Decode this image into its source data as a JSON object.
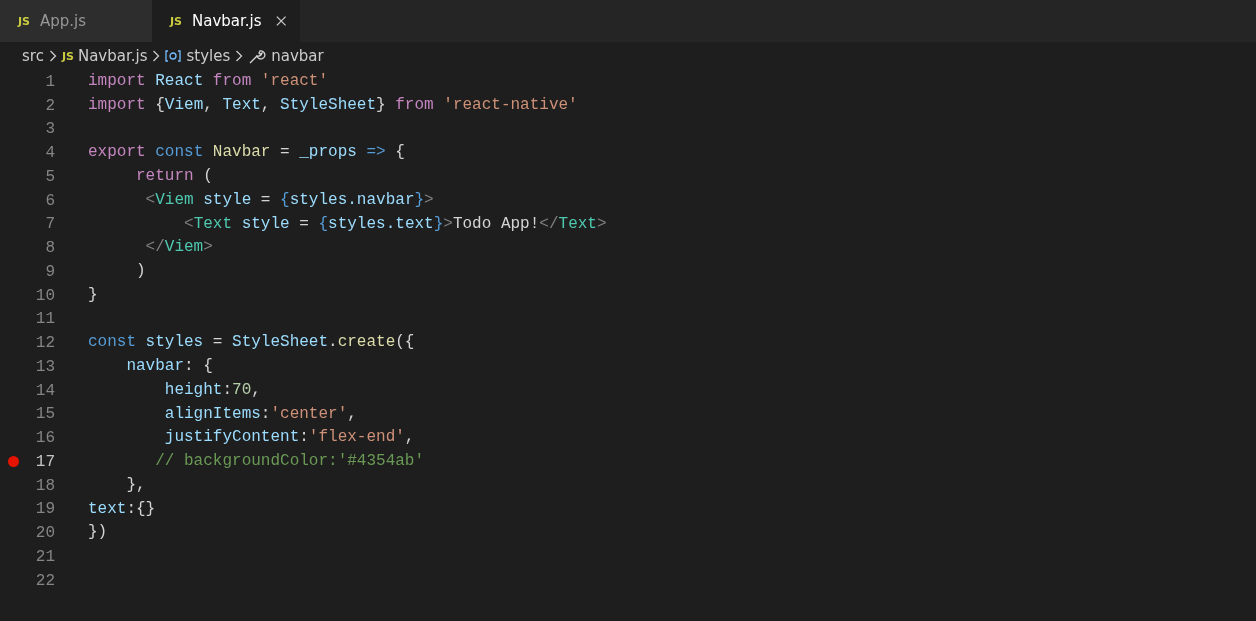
{
  "tabs": [
    {
      "icon_text": "JS",
      "label": "App.js",
      "selected": false
    },
    {
      "icon_text": "JS",
      "label": "Navbar.js",
      "selected": true
    }
  ],
  "breadcrumb": [
    {
      "kind": "folder",
      "label": "src"
    },
    {
      "kind": "file",
      "icon_text": "JS",
      "label": "Navbar.js"
    },
    {
      "kind": "variable",
      "label": "styles"
    },
    {
      "kind": "property",
      "label": "navbar"
    }
  ],
  "lines": [
    {
      "number": "1",
      "breakpoint": false,
      "tokens": [
        {
          "kind": "keyword",
          "text": "import "
        },
        {
          "kind": "variable",
          "text": "React "
        },
        {
          "kind": "keyword",
          "text": "from "
        },
        {
          "kind": "string",
          "text": "'react'"
        }
      ]
    },
    {
      "number": "2",
      "breakpoint": false,
      "tokens": [
        {
          "kind": "keyword",
          "text": "import "
        },
        {
          "kind": "plain",
          "text": "{"
        },
        {
          "kind": "variable",
          "text": "Viem"
        },
        {
          "kind": "plain",
          "text": ", "
        },
        {
          "kind": "variable",
          "text": "Text"
        },
        {
          "kind": "plain",
          "text": ", "
        },
        {
          "kind": "variable",
          "text": "StyleSheet"
        },
        {
          "kind": "plain",
          "text": "} "
        },
        {
          "kind": "keyword",
          "text": "from "
        },
        {
          "kind": "string",
          "text": "'react-native'"
        }
      ]
    },
    {
      "number": "3",
      "breakpoint": false
    },
    {
      "number": "4",
      "breakpoint": false,
      "tokens": [
        {
          "kind": "keyword",
          "text": "export "
        },
        {
          "kind": "storage",
          "text": "const "
        },
        {
          "kind": "function",
          "text": "Navbar "
        },
        {
          "kind": "plain",
          "text": "= "
        },
        {
          "kind": "variable",
          "text": "_props "
        },
        {
          "kind": "storage",
          "text": "=> "
        },
        {
          "kind": "plain",
          "text": "{"
        }
      ]
    },
    {
      "number": "5",
      "breakpoint": false,
      "tokens": [
        {
          "kind": "keyword",
          "text": "     return "
        },
        {
          "kind": "plain",
          "text": "("
        }
      ]
    },
    {
      "number": "6",
      "breakpoint": false,
      "tokens": [
        {
          "kind": "tag-bracket",
          "text": "      <"
        },
        {
          "kind": "type",
          "text": "Viem "
        },
        {
          "kind": "variable",
          "text": "style "
        },
        {
          "kind": "plain",
          "text": "= "
        },
        {
          "kind": "brace",
          "text": "{"
        },
        {
          "kind": "variable",
          "text": "styles.navbar"
        },
        {
          "kind": "brace",
          "text": "}"
        },
        {
          "kind": "tag-bracket",
          "text": ">"
        }
      ]
    },
    {
      "number": "7",
      "breakpoint": false,
      "tokens": [
        {
          "kind": "tag-bracket",
          "text": "          <"
        },
        {
          "kind": "type",
          "text": "Text "
        },
        {
          "kind": "variable",
          "text": "style "
        },
        {
          "kind": "plain",
          "text": "= "
        },
        {
          "kind": "brace",
          "text": "{"
        },
        {
          "kind": "variable",
          "text": "styles.text"
        },
        {
          "kind": "brace",
          "text": "}"
        },
        {
          "kind": "tag-bracket",
          "text": ">"
        },
        {
          "kind": "plain",
          "text": "Todo App!"
        },
        {
          "kind": "tag-bracket",
          "text": "</"
        },
        {
          "kind": "type",
          "text": "Text"
        },
        {
          "kind": "tag-bracket",
          "text": ">"
        }
      ]
    },
    {
      "number": "8",
      "breakpoint": false,
      "tokens": [
        {
          "kind": "tag-bracket",
          "text": "      </"
        },
        {
          "kind": "type",
          "text": "Viem"
        },
        {
          "kind": "tag-bracket",
          "text": ">"
        }
      ]
    },
    {
      "number": "9",
      "breakpoint": false,
      "tokens": [
        {
          "kind": "plain",
          "text": "     )"
        }
      ]
    },
    {
      "number": "10",
      "breakpoint": false,
      "tokens": [
        {
          "kind": "plain",
          "text": "}"
        }
      ]
    },
    {
      "number": "11",
      "breakpoint": false
    },
    {
      "number": "12",
      "breakpoint": false,
      "tokens": [
        {
          "kind": "storage",
          "text": "const "
        },
        {
          "kind": "variable",
          "text": "styles "
        },
        {
          "kind": "plain",
          "text": "= "
        },
        {
          "kind": "variable",
          "text": "StyleSheet"
        },
        {
          "kind": "plain",
          "text": "."
        },
        {
          "kind": "function",
          "text": "create"
        },
        {
          "kind": "plain",
          "text": "({"
        }
      ]
    },
    {
      "number": "13",
      "breakpoint": false,
      "tokens": [
        {
          "kind": "variable",
          "text": "    navbar"
        },
        {
          "kind": "plain",
          "text": ": {"
        }
      ]
    },
    {
      "number": "14",
      "breakpoint": false,
      "tokens": [
        {
          "kind": "variable",
          "text": "        height"
        },
        {
          "kind": "plain",
          "text": ":"
        },
        {
          "kind": "number",
          "text": "70"
        },
        {
          "kind": "plain",
          "text": ","
        }
      ]
    },
    {
      "number": "15",
      "breakpoint": false,
      "tokens": [
        {
          "kind": "variable",
          "text": "        alignItems"
        },
        {
          "kind": "plain",
          "text": ":"
        },
        {
          "kind": "string",
          "text": "'center'"
        },
        {
          "kind": "plain",
          "text": ","
        }
      ]
    },
    {
      "number": "16",
      "breakpoint": false,
      "tokens": [
        {
          "kind": "variable",
          "text": "        justifyContent"
        },
        {
          "kind": "plain",
          "text": ":"
        },
        {
          "kind": "string",
          "text": "'flex-end'"
        },
        {
          "kind": "plain",
          "text": ","
        }
      ]
    },
    {
      "number": "17",
      "breakpoint": true,
      "tokens": [
        {
          "kind": "comment",
          "text": "       // backgroundColor:'#4354ab'"
        }
      ]
    },
    {
      "number": "18",
      "breakpoint": false,
      "tokens": [
        {
          "kind": "plain",
          "text": "    },"
        }
      ]
    },
    {
      "number": "19",
      "breakpoint": false,
      "tokens": [
        {
          "kind": "variable",
          "text": "text"
        },
        {
          "kind": "plain",
          "text": ":{}"
        }
      ]
    },
    {
      "number": "20",
      "breakpoint": false,
      "tokens": [
        {
          "kind": "plain",
          "text": "})"
        }
      ]
    },
    {
      "number": "21",
      "breakpoint": false
    },
    {
      "number": "22",
      "breakpoint": false
    }
  ]
}
